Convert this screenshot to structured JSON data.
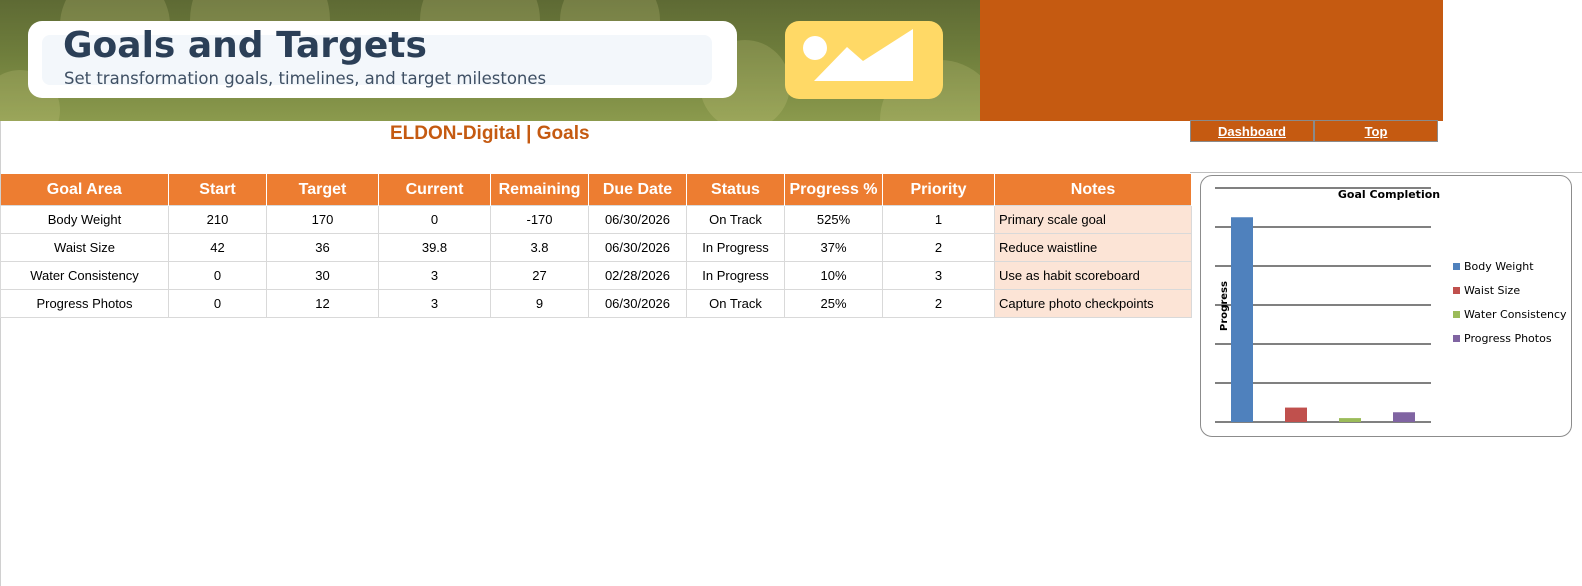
{
  "header": {
    "title": "Goals and Targets",
    "subtitle": "Set transformation goals, timelines, and target milestones",
    "image_icon": "image-placeholder-icon"
  },
  "brand": "ELDON-Digital | Goals",
  "nav": {
    "dashboard": "Dashboard",
    "top": "Top"
  },
  "table": {
    "columns": [
      "Goal Area",
      "Start",
      "Target",
      "Current",
      "Remaining",
      "Due Date",
      "Status",
      "Progress %",
      "Priority",
      "Notes"
    ],
    "rows": [
      [
        "Body Weight",
        "210",
        "170",
        "0",
        "-170",
        "06/30/2026",
        "On Track",
        "525%",
        "1",
        "Primary scale goal"
      ],
      [
        "Waist Size",
        "42",
        "36",
        "39.8",
        "3.8",
        "06/30/2026",
        "In Progress",
        "37%",
        "2",
        "Reduce waistline"
      ],
      [
        "Water Consistency",
        "0",
        "30",
        "3",
        "27",
        "02/28/2026",
        "In Progress",
        "10%",
        "3",
        "Use as habit scoreboard"
      ],
      [
        "Progress Photos",
        "0",
        "12",
        "3",
        "9",
        "06/30/2026",
        "On Track",
        "25%",
        "2",
        "Capture photo checkpoints"
      ]
    ]
  },
  "colors": {
    "header_orange": "#ed7d31",
    "accent": "#c55a11",
    "note_fill": "#fce4d6",
    "title_text": "#2b3f57"
  },
  "chart_data": {
    "type": "bar",
    "title": "Goal Completion",
    "ylabel": "Progress",
    "categories": [
      "Body Weight",
      "Waist Size",
      "Water Consistency",
      "Progress Photos"
    ],
    "values": [
      525,
      37,
      10,
      25
    ],
    "colors": [
      "#4f81bd",
      "#c0504d",
      "#9bbb59",
      "#8064a2"
    ],
    "ylim": [
      0,
      600
    ],
    "grid": true,
    "legend": "right"
  }
}
